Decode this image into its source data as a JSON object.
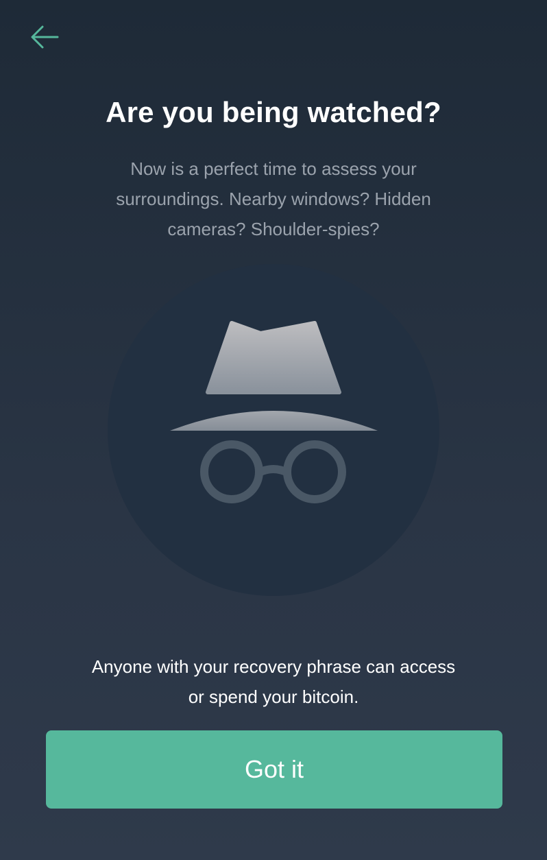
{
  "header": {
    "back_icon": "arrow-left-icon"
  },
  "content": {
    "title": "Are you being watched?",
    "subtitle": "Now is a perfect time to assess your surroundings. Nearby windows? Hidden cameras? Shoulder-spies?",
    "illustration_icon": "incognito-spy-icon",
    "warning": "Anyone with your recovery phrase can access or spend your bitcoin."
  },
  "actions": {
    "confirm_label": "Got it"
  },
  "colors": {
    "accent": "#56b89c",
    "background_top": "#1e2a37",
    "background_bottom": "#2f3a4b",
    "subtitle_text": "#9ba3ad"
  }
}
